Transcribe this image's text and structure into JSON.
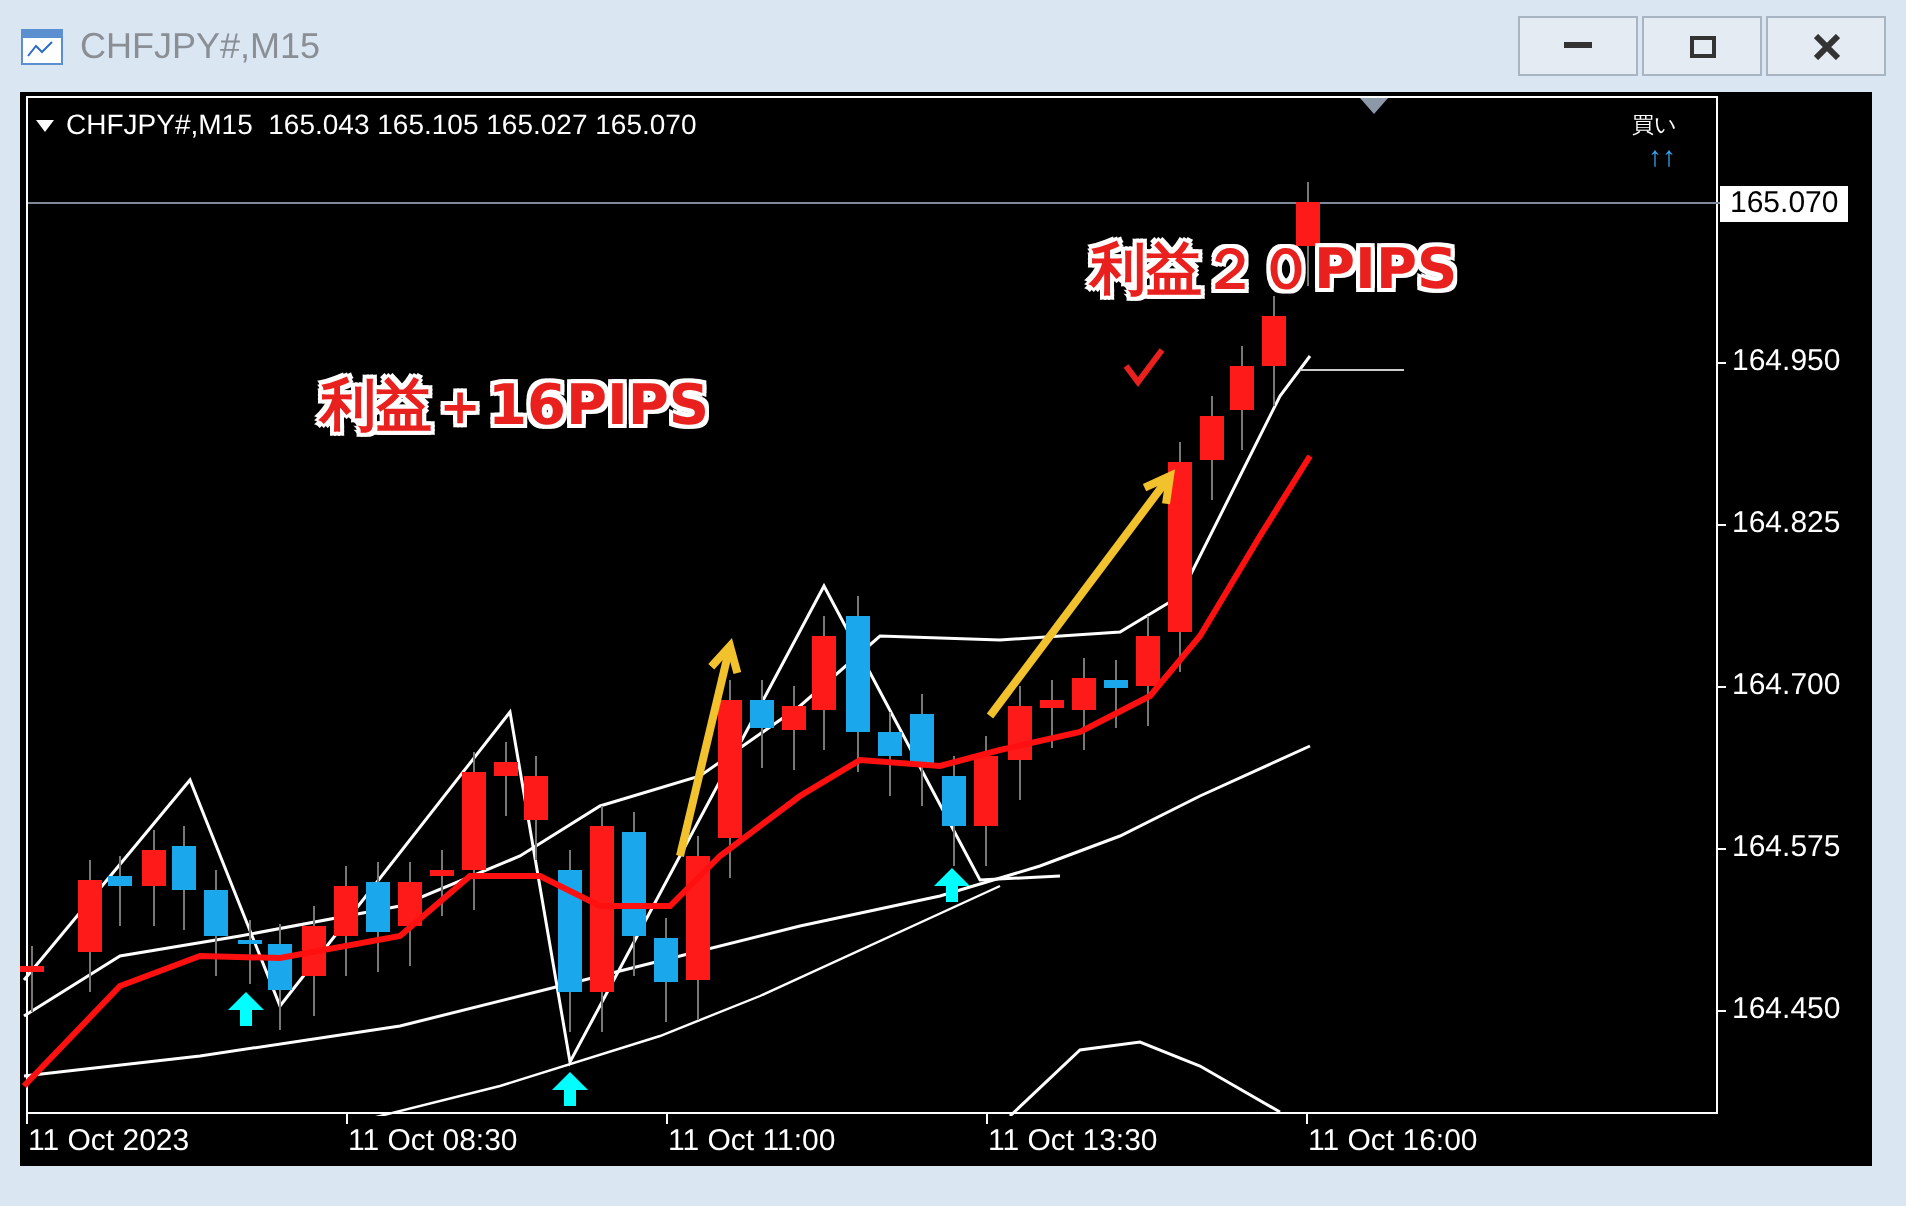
{
  "window": {
    "title": "CHFJPY#,M15"
  },
  "chart": {
    "symbol": "CHFJPY#,M15",
    "ohlc": [
      "165.043",
      "165.105",
      "165.027",
      "165.070"
    ],
    "signal": {
      "label": "買い",
      "arrows": "↑↑"
    },
    "annotations": [
      {
        "text": "利益＋16PIPS"
      },
      {
        "text": "利益２０PIPS"
      }
    ],
    "current_price": "165.070",
    "price_axis": [
      "164.950",
      "164.825",
      "164.700",
      "164.575",
      "164.450"
    ],
    "time_axis": [
      "11 Oct 2023",
      "11 Oct 08:30",
      "11 Oct 11:00",
      "11 Oct 13:30",
      "11 Oct 16:00"
    ]
  }
}
